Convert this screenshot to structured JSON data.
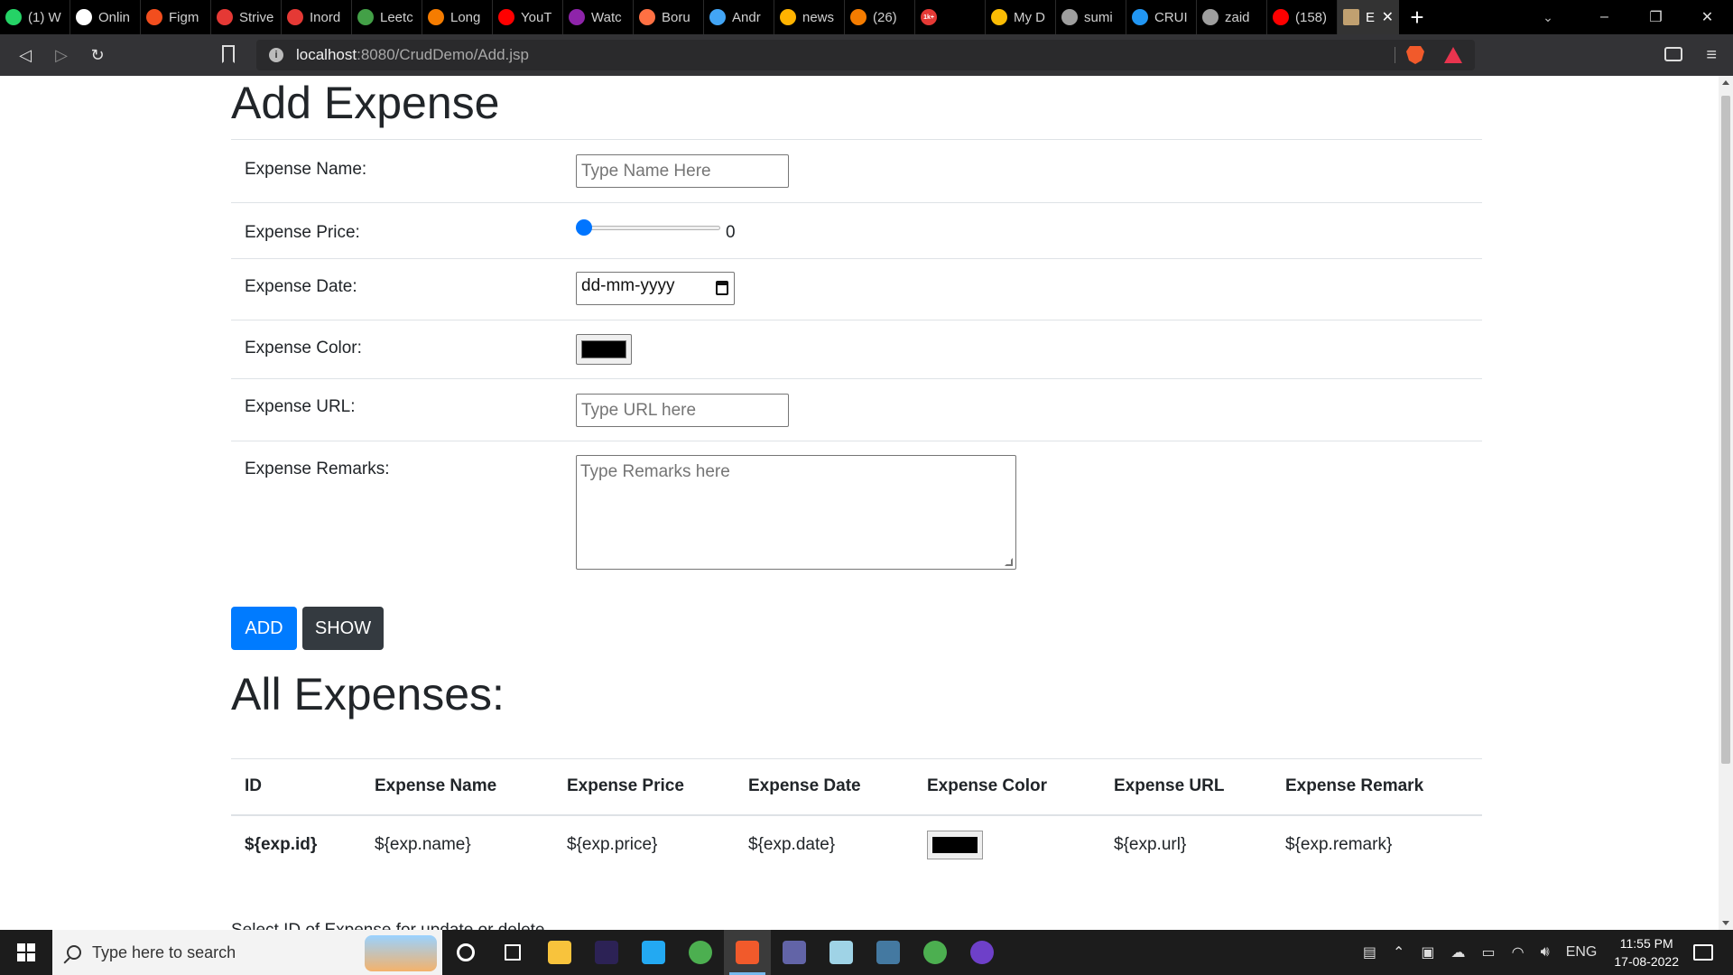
{
  "browser": {
    "tabs": [
      {
        "title": "(1) W",
        "color": "#25d366",
        "icon": "whatsapp-icon"
      },
      {
        "title": "Onlin",
        "color": "#ffffff",
        "icon": "github-icon"
      },
      {
        "title": "Figm",
        "color": "#f24e1e",
        "icon": "figma-icon"
      },
      {
        "title": "Strive",
        "color": "#e53935",
        "icon": "takeuforward-icon"
      },
      {
        "title": "Inord",
        "color": "#e53935",
        "icon": "takeuforward-icon"
      },
      {
        "title": "Leetc",
        "color": "#43a047",
        "icon": "plus-icon"
      },
      {
        "title": "Long",
        "color": "#f57c00",
        "icon": "stackoverflow-icon"
      },
      {
        "title": "YouT",
        "color": "#ff0000",
        "icon": "youtube-icon"
      },
      {
        "title": "Watc",
        "color": "#8e24aa",
        "icon": "play-icon"
      },
      {
        "title": "Boru",
        "color": "#ff7043",
        "icon": "f-icon"
      },
      {
        "title": "Andr",
        "color": "#42a5f5",
        "icon": "code-icon"
      },
      {
        "title": "news",
        "color": "#ffb300",
        "icon": "fire-icon"
      },
      {
        "title": "(26)",
        "color": "#f57c00",
        "icon": "stackoverflow-icon"
      },
      {
        "title": "",
        "color": "#e53935",
        "icon": "badge-icon",
        "badge": "1k+"
      },
      {
        "title": "My D",
        "color": "#fbbc04",
        "icon": "drive-icon"
      },
      {
        "title": "sumi",
        "color": "#9e9e9e",
        "icon": "globe-icon"
      },
      {
        "title": "CRUI",
        "color": "#2196f3",
        "icon": "wordpress-icon"
      },
      {
        "title": "zaid",
        "color": "#9e9e9e",
        "icon": "globe-icon"
      },
      {
        "title": "(158)",
        "color": "#ff0000",
        "icon": "youtube-icon"
      }
    ],
    "active_tab": {
      "title": "E",
      "color": "#c0a070",
      "icon": "page-icon",
      "close": "✕"
    },
    "new_tab": "+",
    "url_host": "localhost",
    "url_path": ":8080/CrudDemo/Add.jsp"
  },
  "form": {
    "title": "Add Expense",
    "name_label": "Expense Name:",
    "name_placeholder": "Type Name Here",
    "price_label": "Expense Price:",
    "price_value": "0",
    "price_fraction": 0,
    "date_label": "Expense Date:",
    "date_placeholder": "dd-mm-yyyy",
    "color_label": "Expense Color:",
    "color_value": "#000000",
    "url_label": "Expense URL:",
    "url_placeholder": "Type URL here",
    "remarks_label": "Expense Remarks:",
    "remarks_placeholder": "Type Remarks here",
    "add_button": "ADD",
    "show_button": "SHOW"
  },
  "list": {
    "title": "All Expenses:",
    "columns": [
      "ID",
      "Expense Name",
      "Expense Price",
      "Expense Date",
      "Expense Color",
      "Expense URL",
      "Expense Remark"
    ],
    "rows": [
      {
        "id": "${exp.id}",
        "name": "${exp.name}",
        "price": "${exp.price}",
        "date": "${exp.date}",
        "color": "#000000",
        "url": "${exp.url}",
        "remark": "${exp.remark}"
      }
    ],
    "cutoff_text": "Select ID of Expense for update or delete"
  },
  "taskbar": {
    "search_placeholder": "Type here to search",
    "apps": [
      "cortana-icon",
      "task-view-icon",
      "file-explorer-icon",
      "eclipse-icon",
      "vscode-icon",
      "chrome-icon",
      "brave-icon",
      "teams-icon",
      "notepad-icon",
      "mysql-workbench-icon",
      "chrome-profile-icon",
      "github-desktop-icon"
    ],
    "language": "ENG",
    "time": "11:55 PM",
    "date": "17-08-2022"
  },
  "colors": {
    "primary": "#007bff",
    "dark": "#343a40",
    "slider": "#0075ff"
  }
}
